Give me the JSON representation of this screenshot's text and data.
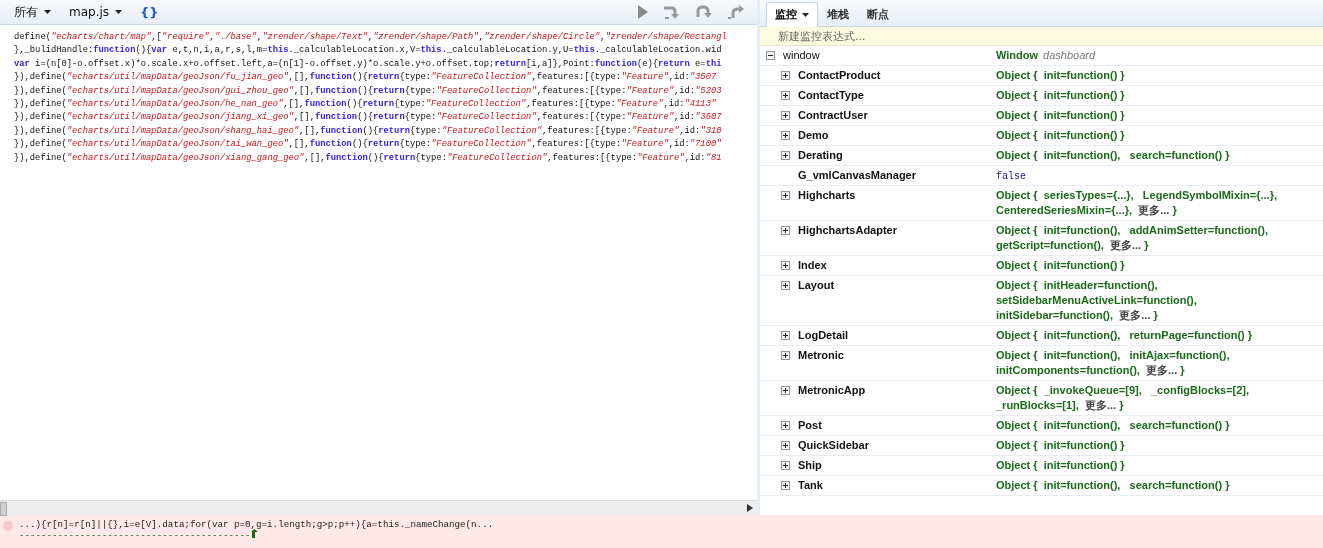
{
  "toolbar": {
    "scope_menu": "所有",
    "file_menu": "map.js",
    "pretty_print": "{}"
  },
  "code_lines": [
    [
      {
        "kind": "plain",
        "text": "define("
      },
      {
        "kind": "str",
        "text": "\"echarts/chart/map\""
      },
      {
        "kind": "plain",
        "text": ",["
      },
      {
        "kind": "str",
        "text": "\"require\""
      },
      {
        "kind": "plain",
        "text": ","
      },
      {
        "kind": "str",
        "text": "\"./base\""
      },
      {
        "kind": "plain",
        "text": ","
      },
      {
        "kind": "str",
        "text": "\"zrender/shape/Text\""
      },
      {
        "kind": "plain",
        "text": ","
      },
      {
        "kind": "str",
        "text": "\"zrender/shape/Path\""
      },
      {
        "kind": "plain",
        "text": ","
      },
      {
        "kind": "str",
        "text": "\"zrender/shape/Circle\""
      },
      {
        "kind": "plain",
        "text": ","
      },
      {
        "kind": "str",
        "text": "\"zrender/shape/Rectangl"
      }
    ],
    [
      {
        "kind": "plain",
        "text": "},_bulidHandle:"
      },
      {
        "kind": "kw",
        "text": "function"
      },
      {
        "kind": "plain",
        "text": "(){"
      },
      {
        "kind": "kw",
        "text": "var"
      },
      {
        "kind": "plain",
        "text": " e,t,n,i,a,r,s,l,m="
      },
      {
        "kind": "kw",
        "text": "this"
      },
      {
        "kind": "plain",
        "text": "._calculableLocation.x,V="
      },
      {
        "kind": "kw",
        "text": "this"
      },
      {
        "kind": "plain",
        "text": "._calculableLocation.y,U="
      },
      {
        "kind": "kw",
        "text": "this"
      },
      {
        "kind": "plain",
        "text": "._calculableLocation.wid"
      }
    ],
    [
      {
        "kind": "kw",
        "text": "var"
      },
      {
        "kind": "plain",
        "text": " i=(n[0]-o.offset.x)*o.scale.x+o.offset.left,a=(n[1]-o.offset.y)*o.scale.y+o.offset.top;"
      },
      {
        "kind": "kw",
        "text": "return"
      },
      {
        "kind": "plain",
        "text": "[i,a]},Point:"
      },
      {
        "kind": "kw",
        "text": "function"
      },
      {
        "kind": "plain",
        "text": "(e){"
      },
      {
        "kind": "kw",
        "text": "return"
      },
      {
        "kind": "plain",
        "text": " e="
      },
      {
        "kind": "kw",
        "text": "thi"
      }
    ],
    [
      {
        "kind": "plain",
        "text": "}),define("
      },
      {
        "kind": "str",
        "text": "\"echarts/util/mapData/geoJson/fu_jian_geo\""
      },
      {
        "kind": "plain",
        "text": ",[],"
      },
      {
        "kind": "kw",
        "text": "function"
      },
      {
        "kind": "plain",
        "text": "(){"
      },
      {
        "kind": "kw",
        "text": "return"
      },
      {
        "kind": "plain",
        "text": "{type:"
      },
      {
        "kind": "str",
        "text": "\"FeatureCollection\""
      },
      {
        "kind": "plain",
        "text": ",features:[{type:"
      },
      {
        "kind": "str",
        "text": "\"Feature\""
      },
      {
        "kind": "plain",
        "text": ",id:"
      },
      {
        "kind": "str",
        "text": "\"3507"
      }
    ],
    [
      {
        "kind": "plain",
        "text": "}),define("
      },
      {
        "kind": "str",
        "text": "\"echarts/util/mapData/geoJson/gui_zhou_geo\""
      },
      {
        "kind": "plain",
        "text": ",[],"
      },
      {
        "kind": "kw",
        "text": "function"
      },
      {
        "kind": "plain",
        "text": "(){"
      },
      {
        "kind": "kw",
        "text": "return"
      },
      {
        "kind": "plain",
        "text": "{type:"
      },
      {
        "kind": "str",
        "text": "\"FeatureCollection\""
      },
      {
        "kind": "plain",
        "text": ",features:[{type:"
      },
      {
        "kind": "str",
        "text": "\"Feature\""
      },
      {
        "kind": "plain",
        "text": ",id:"
      },
      {
        "kind": "str",
        "text": "\"5203"
      }
    ],
    [
      {
        "kind": "plain",
        "text": "}),define("
      },
      {
        "kind": "str",
        "text": "\"echarts/util/mapData/geoJson/he_nan_geo\""
      },
      {
        "kind": "plain",
        "text": ",[],"
      },
      {
        "kind": "kw",
        "text": "function"
      },
      {
        "kind": "plain",
        "text": "(){"
      },
      {
        "kind": "kw",
        "text": "return"
      },
      {
        "kind": "plain",
        "text": "{type:"
      },
      {
        "kind": "str",
        "text": "\"FeatureCollection\""
      },
      {
        "kind": "plain",
        "text": ",features:[{type:"
      },
      {
        "kind": "str",
        "text": "\"Feature\""
      },
      {
        "kind": "plain",
        "text": ",id:"
      },
      {
        "kind": "str",
        "text": "\"4113\""
      }
    ],
    [
      {
        "kind": "plain",
        "text": "}),define("
      },
      {
        "kind": "str",
        "text": "\"echarts/util/mapData/geoJson/jiang_xi_geo\""
      },
      {
        "kind": "plain",
        "text": ",[],"
      },
      {
        "kind": "kw",
        "text": "function"
      },
      {
        "kind": "plain",
        "text": "(){"
      },
      {
        "kind": "kw",
        "text": "return"
      },
      {
        "kind": "plain",
        "text": "{type:"
      },
      {
        "kind": "str",
        "text": "\"FeatureCollection\""
      },
      {
        "kind": "plain",
        "text": ",features:[{type:"
      },
      {
        "kind": "str",
        "text": "\"Feature\""
      },
      {
        "kind": "plain",
        "text": ",id:"
      },
      {
        "kind": "str",
        "text": "\"3607"
      }
    ],
    [
      {
        "kind": "plain",
        "text": "}),define("
      },
      {
        "kind": "str",
        "text": "\"echarts/util/mapData/geoJson/shang_hai_geo\""
      },
      {
        "kind": "plain",
        "text": ",[],"
      },
      {
        "kind": "kw",
        "text": "function"
      },
      {
        "kind": "plain",
        "text": "(){"
      },
      {
        "kind": "kw",
        "text": "return"
      },
      {
        "kind": "plain",
        "text": "{type:"
      },
      {
        "kind": "str",
        "text": "\"FeatureCollection\""
      },
      {
        "kind": "plain",
        "text": ",features:[{type:"
      },
      {
        "kind": "str",
        "text": "\"Feature\""
      },
      {
        "kind": "plain",
        "text": ",id:"
      },
      {
        "kind": "str",
        "text": "\"310"
      }
    ],
    [
      {
        "kind": "plain",
        "text": "}),define("
      },
      {
        "kind": "str",
        "text": "\"echarts/util/mapData/geoJson/tai_wan_geo\""
      },
      {
        "kind": "plain",
        "text": ",[],"
      },
      {
        "kind": "kw",
        "text": "function"
      },
      {
        "kind": "plain",
        "text": "(){"
      },
      {
        "kind": "kw",
        "text": "return"
      },
      {
        "kind": "plain",
        "text": "{type:"
      },
      {
        "kind": "str",
        "text": "\"FeatureCollection\""
      },
      {
        "kind": "plain",
        "text": ",features:[{type:"
      },
      {
        "kind": "str",
        "text": "\"Feature\""
      },
      {
        "kind": "plain",
        "text": ",id:"
      },
      {
        "kind": "str",
        "text": "\"7100\""
      }
    ],
    [
      {
        "kind": "plain",
        "text": "}),define("
      },
      {
        "kind": "str",
        "text": "\"echarts/util/mapData/geoJson/xiang_gang_geo\""
      },
      {
        "kind": "plain",
        "text": ",[],"
      },
      {
        "kind": "kw",
        "text": "function"
      },
      {
        "kind": "plain",
        "text": "(){"
      },
      {
        "kind": "kw",
        "text": "return"
      },
      {
        "kind": "plain",
        "text": "{type:"
      },
      {
        "kind": "str",
        "text": "\"FeatureCollection\""
      },
      {
        "kind": "plain",
        "text": ",features:[{type:"
      },
      {
        "kind": "str",
        "text": "\"Feature\""
      },
      {
        "kind": "plain",
        "text": ",id:"
      },
      {
        "kind": "str",
        "text": "\"81"
      }
    ]
  ],
  "tabs": [
    {
      "label": "监控",
      "selected": true,
      "menu": true
    },
    {
      "label": "堆栈",
      "selected": false,
      "menu": false
    },
    {
      "label": "断点",
      "selected": false,
      "menu": false
    }
  ],
  "new_watch": {
    "placeholder": "新建监控表达式..."
  },
  "watch_tree": [
    {
      "name": "window",
      "kind": "window",
      "expanded": true,
      "value": "Window",
      "value_note": "dashboard",
      "children": [
        {
          "name": "ContactProduct",
          "kind": "object",
          "expanded": false,
          "value": "Object {  init=function() }"
        },
        {
          "name": "ContactType",
          "kind": "object",
          "expanded": false,
          "value": "Object {  init=function() }"
        },
        {
          "name": "ContractUser",
          "kind": "object",
          "expanded": false,
          "value": "Object {  init=function() }"
        },
        {
          "name": "Demo",
          "kind": "object",
          "expanded": false,
          "value": "Object {  init=function() }"
        },
        {
          "name": "Derating",
          "kind": "object",
          "expanded": false,
          "value": "Object {  init=function(),   search=function() }"
        },
        {
          "name": "G_vmlCanvasManager",
          "kind": "boolean",
          "value": "false"
        },
        {
          "name": "Highcharts",
          "kind": "object",
          "expanded": false,
          "value": "Object {  seriesTypes={...},   LegendSymbolMixin={...},   CenteredSeriesMixin={...},",
          "more": "更多...",
          "close": "}"
        },
        {
          "name": "HighchartsAdapter",
          "kind": "object",
          "expanded": false,
          "value": "Object {  init=function(),   addAnimSetter=function(),   getScript=function(),",
          "more": "更多...",
          "close": "}"
        },
        {
          "name": "Index",
          "kind": "object",
          "expanded": false,
          "value": "Object {  init=function() }"
        },
        {
          "name": "Layout",
          "kind": "object",
          "expanded": false,
          "value": "Object {  initHeader=function(),   setSidebarMenuActiveLink=function(),   initSidebar=function(),",
          "more": "更多...",
          "close": "}"
        },
        {
          "name": "LogDetail",
          "kind": "object",
          "expanded": false,
          "value": "Object {  init=function(),   returnPage=function() }"
        },
        {
          "name": "Metronic",
          "kind": "object",
          "expanded": false,
          "value": "Object {  init=function(),   initAjax=function(),   initComponents=function(),",
          "more": "更多...",
          "close": "}"
        },
        {
          "name": "MetronicApp",
          "kind": "object",
          "expanded": false,
          "value": "Object {  _invokeQueue=[9],   _configBlocks=[2],   _runBlocks=[1],",
          "more": "更多...",
          "close": "}"
        },
        {
          "name": "Post",
          "kind": "object",
          "expanded": false,
          "value": "Object {  init=function(),   search=function() }"
        },
        {
          "name": "QuickSidebar",
          "kind": "object",
          "expanded": false,
          "value": "Object {  init=function() }"
        },
        {
          "name": "Ship",
          "kind": "object",
          "expanded": false,
          "value": "Object {  init=function() }"
        },
        {
          "name": "Tank",
          "kind": "object",
          "expanded": false,
          "value": "Object {  init=function(),   search=function() }"
        }
      ]
    }
  ],
  "error": {
    "source": "...){r[n]=r[n]||{},i=e[V].data;for(var p=0,g=i.length;g>p;p++){a=this._nameChange(n...",
    "pointer": "------------------------------------------"
  }
}
